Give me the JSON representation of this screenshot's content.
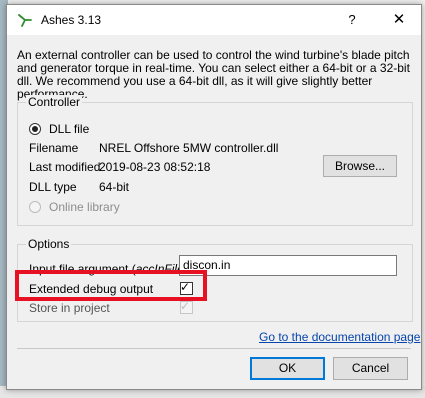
{
  "window": {
    "title": "Ashes 3.13",
    "help_label": "?",
    "close_label": "✕"
  },
  "description": "An external controller can be used to control the wind turbine's blade pitch and generator torque in real-time. You can select either a 64-bit or a 32-bit dll. We recommend you use a 64-bit dll, as it will give slightly better performance.",
  "controller": {
    "legend": "Controller",
    "dll_option_label": "DLL file",
    "filename_label": "Filename",
    "filename_value": "NREL Offshore 5MW controller.dll",
    "modified_label": "Last modified",
    "modified_value": "2019-08-23 08:52:18",
    "type_label": "DLL type",
    "type_value": "64-bit",
    "browse_label": "Browse...",
    "online_option_label": "Online library"
  },
  "options": {
    "legend": "Options",
    "input_arg_prefix": "Input file argument (",
    "input_arg_italic": "accInFile",
    "input_arg_suffix": ")",
    "input_arg_value": "discon.in",
    "extended_debug_label": "Extended debug output",
    "extended_debug_checked": true,
    "store_label": "Store in project",
    "store_checked": true
  },
  "footer": {
    "doc_link": "Go to the documentation page",
    "ok_label": "OK",
    "cancel_label": "Cancel"
  },
  "colors": {
    "highlight": "#e81123",
    "link": "#0645ad",
    "default_button_border": "#0078d7",
    "icon_green": "#2e8b2e"
  }
}
